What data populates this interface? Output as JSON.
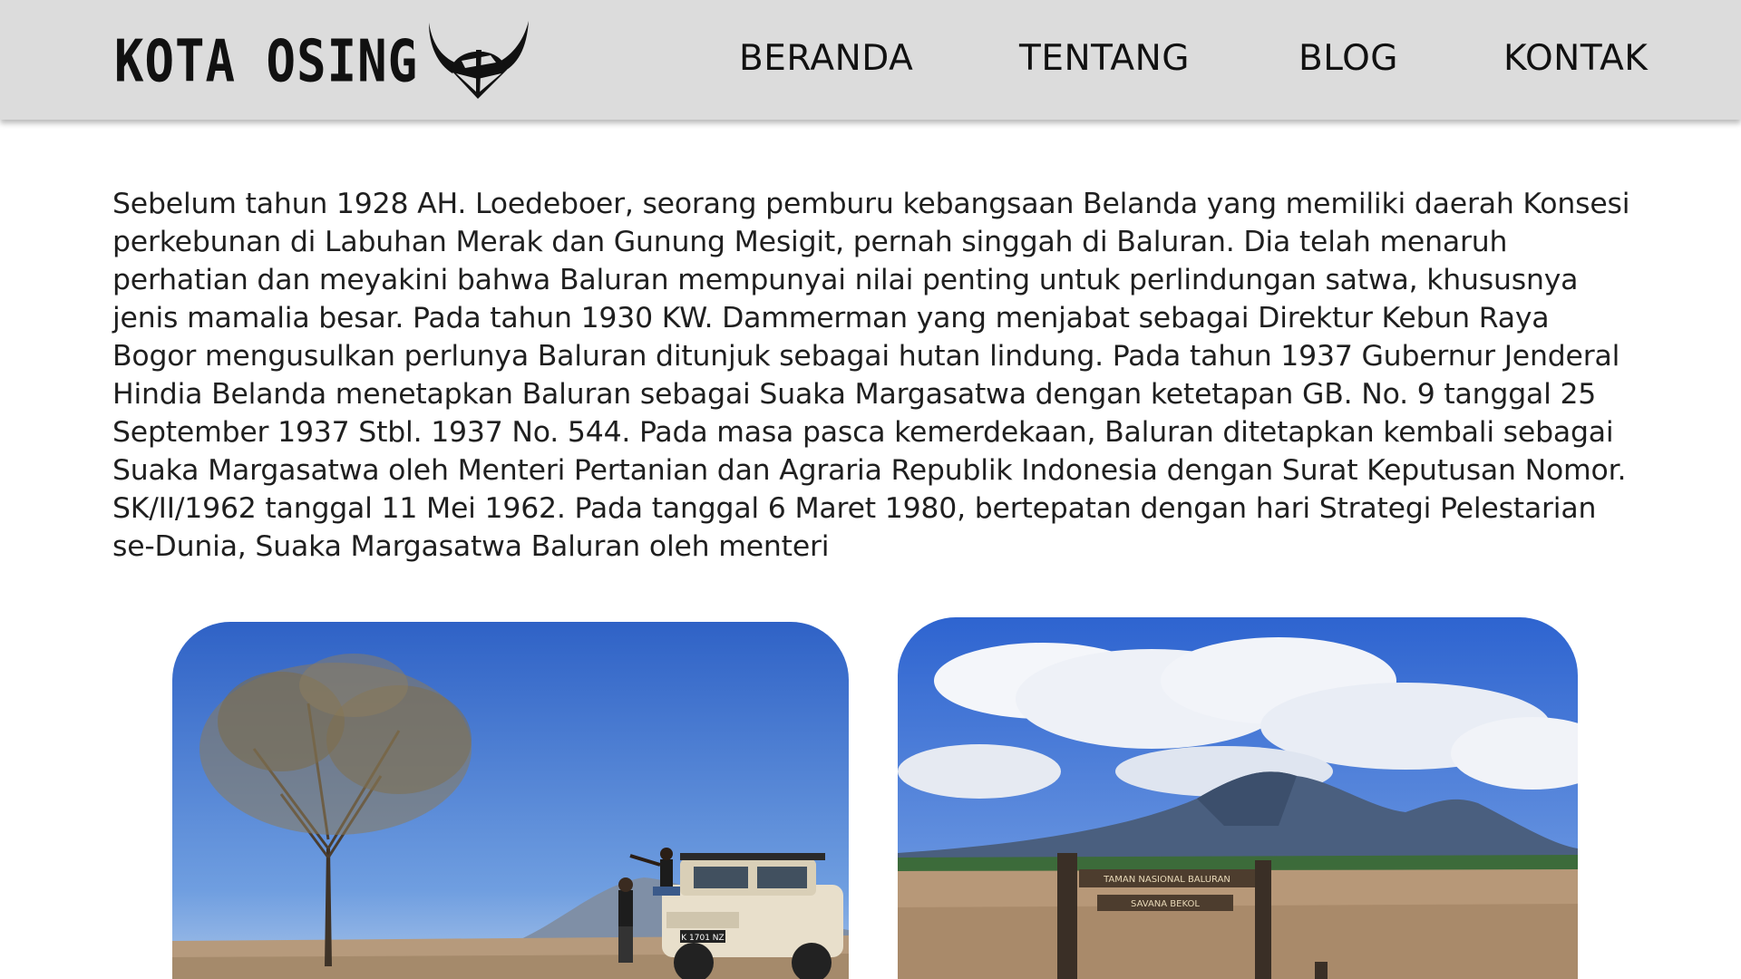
{
  "header": {
    "brand": "KOTA OSING",
    "logo_icon": "horned-helmet-icon",
    "nav": [
      {
        "label": "BERANDA"
      },
      {
        "label": "TENTANG"
      },
      {
        "label": "BLOG"
      },
      {
        "label": "KONTAK"
      }
    ]
  },
  "article": {
    "paragraph": "Sebelum tahun 1928 AH. Loedeboer, seorang pemburu kebangsaan Belanda yang memiliki daerah Konsesi perkebunan di Labuhan Merak dan Gunung Mesigit, pernah singgah di Baluran. Dia telah menaruh perhatian dan meyakini bahwa Baluran mempunyai nilai penting untuk perlindungan satwa, khususnya jenis mamalia besar. Pada tahun 1930 KW. Dammerman yang menjabat sebagai Direktur Kebun Raya Bogor mengusulkan perlunya Baluran ditunjuk sebagai hutan lindung. Pada tahun 1937 Gubernur Jenderal Hindia Belanda menetapkan Baluran sebagai Suaka Margasatwa dengan ketetapan GB. No. 9 tanggal 25 September 1937 Stbl. 1937 No. 544. Pada masa pasca kemerdekaan, Baluran ditetapkan kembali sebagai Suaka Margasatwa oleh Menteri Pertanian dan Agraria Republik Indonesia dengan Surat Keputusan Nomor. SK/II/1962 tanggal 11 Mei 1962. Pada tanggal 6 Maret 1980, bertepatan dengan hari Strategi Pelestarian se-Dunia, Suaka Margasatwa Baluran oleh menteri"
  },
  "gallery": {
    "photo_left": {
      "plate": "K 1701 NZ"
    },
    "photo_right": {
      "sign_line1": "TAMAN NASIONAL BALURAN",
      "sign_line2": "SAVANA BEKOL"
    }
  },
  "colors": {
    "navbar_bg": "#dcdcdc",
    "text": "#1f1f1f",
    "sky": "#3f74c9",
    "savanna": "#b89a78"
  }
}
